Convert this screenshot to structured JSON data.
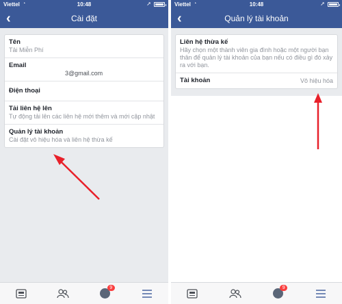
{
  "status": {
    "carrier": "Viettel",
    "time": "10:48"
  },
  "left": {
    "title": "Cài đặt",
    "rows": [
      {
        "label": "Tên",
        "value": "Tải Miễn Phí"
      },
      {
        "label": "Email",
        "value": "3@gmail.com"
      },
      {
        "label": "Điện thoại",
        "value": ""
      },
      {
        "label": "Tải liên hệ lên",
        "value": "Tự động tải lên các liên hệ mới thêm và mới cập nhật"
      },
      {
        "label": "Quản lý tài khoản",
        "value": "Cài đặt vô hiệu hóa và liên hệ thừa kế"
      }
    ]
  },
  "right": {
    "title": "Quản lý tài khoản",
    "legacy": {
      "label": "Liên hệ thừa kế",
      "desc": "Hãy chọn một thành viên gia đình hoặc một người bạn thân để quản lý tài khoản của bạn nếu có điều gì đó xảy ra với bạn."
    },
    "account": {
      "label": "Tài khoản",
      "value": "Vô hiệu hóa"
    }
  },
  "tabbar": {
    "badge": "9"
  },
  "colors": {
    "brand": "#3b5998",
    "arrow": "#e8202a",
    "badge": "#fa3e3e"
  }
}
